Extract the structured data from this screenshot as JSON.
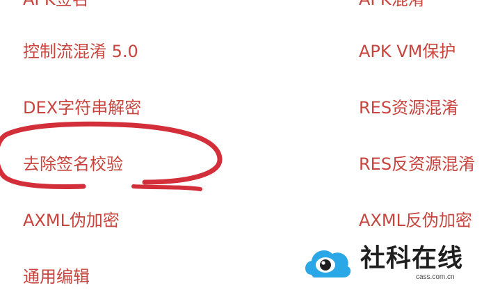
{
  "colors": {
    "item_text": "#c8453f",
    "annotation": "#d32f3a",
    "background": "#ffffff",
    "watermark_blue": "#2aa7e6",
    "watermark_dark": "#1f1f1f"
  },
  "menu": {
    "left": [
      {
        "label": "APK签名",
        "partial": "top-cut"
      },
      {
        "label": "控制流混淆 5.0"
      },
      {
        "label": "DEX字符串解密"
      },
      {
        "label": "去除签名校验",
        "highlighted": true
      },
      {
        "label": "AXML伪加密"
      },
      {
        "label": "通用编辑"
      }
    ],
    "right": [
      {
        "label": "APK混淆",
        "partial": "top-cut"
      },
      {
        "label": "APK VM保护"
      },
      {
        "label": "RES资源混淆"
      },
      {
        "label": "RES反资源混淆"
      },
      {
        "label": "AXML反伪加密"
      }
    ]
  },
  "watermark": {
    "icon": "cloud-eye-logo-icon",
    "name": "社科在线",
    "domain": "cass.com.cn"
  }
}
